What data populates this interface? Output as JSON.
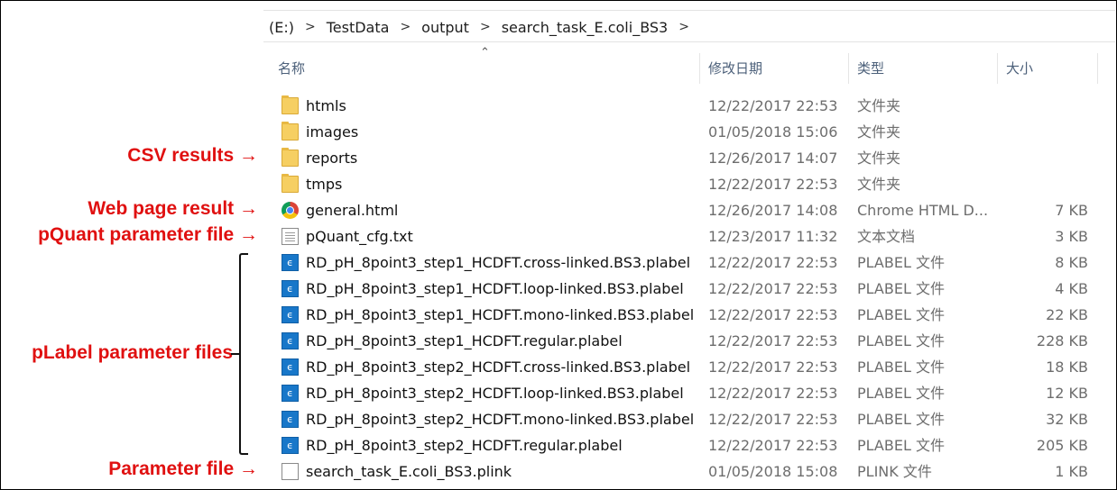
{
  "breadcrumb": [
    "(E:)",
    "TestData",
    "output",
    "search_task_E.coli_BS3"
  ],
  "columns": {
    "name": "名称",
    "date": "修改日期",
    "type": "类型",
    "size": "大小"
  },
  "files": [
    {
      "name": "htmls",
      "date": "12/22/2017 22:53",
      "type": "文件夹",
      "size": "",
      "icon": "folder-icon"
    },
    {
      "name": "images",
      "date": "01/05/2018 15:06",
      "type": "文件夹",
      "size": "",
      "icon": "folder-icon"
    },
    {
      "name": "reports",
      "date": "12/26/2017 14:07",
      "type": "文件夹",
      "size": "",
      "icon": "folder-icon"
    },
    {
      "name": "tmps",
      "date": "12/22/2017 22:53",
      "type": "文件夹",
      "size": "",
      "icon": "folder-icon"
    },
    {
      "name": "general.html",
      "date": "12/26/2017 14:08",
      "type": "Chrome HTML D...",
      "size": "7 KB",
      "icon": "chrome-icon"
    },
    {
      "name": "pQuant_cfg.txt",
      "date": "12/23/2017 11:32",
      "type": "文本文档",
      "size": "3 KB",
      "icon": "text-file-icon"
    },
    {
      "name": "RD_pH_8point3_step1_HCDFT.cross-linked.BS3.plabel",
      "date": "12/22/2017 22:53",
      "type": "PLABEL 文件",
      "size": "8 KB",
      "icon": "plabel-file-icon"
    },
    {
      "name": "RD_pH_8point3_step1_HCDFT.loop-linked.BS3.plabel",
      "date": "12/22/2017 22:53",
      "type": "PLABEL 文件",
      "size": "4 KB",
      "icon": "plabel-file-icon"
    },
    {
      "name": "RD_pH_8point3_step1_HCDFT.mono-linked.BS3.plabel",
      "date": "12/22/2017 22:53",
      "type": "PLABEL 文件",
      "size": "22 KB",
      "icon": "plabel-file-icon"
    },
    {
      "name": "RD_pH_8point3_step1_HCDFT.regular.plabel",
      "date": "12/22/2017 22:53",
      "type": "PLABEL 文件",
      "size": "228 KB",
      "icon": "plabel-file-icon"
    },
    {
      "name": "RD_pH_8point3_step2_HCDFT.cross-linked.BS3.plabel",
      "date": "12/22/2017 22:53",
      "type": "PLABEL 文件",
      "size": "18 KB",
      "icon": "plabel-file-icon"
    },
    {
      "name": "RD_pH_8point3_step2_HCDFT.loop-linked.BS3.plabel",
      "date": "12/22/2017 22:53",
      "type": "PLABEL 文件",
      "size": "12 KB",
      "icon": "plabel-file-icon"
    },
    {
      "name": "RD_pH_8point3_step2_HCDFT.mono-linked.BS3.plabel",
      "date": "12/22/2017 22:53",
      "type": "PLABEL 文件",
      "size": "32 KB",
      "icon": "plabel-file-icon"
    },
    {
      "name": "RD_pH_8point3_step2_HCDFT.regular.plabel",
      "date": "12/22/2017 22:53",
      "type": "PLABEL 文件",
      "size": "205 KB",
      "icon": "plabel-file-icon"
    },
    {
      "name": "search_task_E.coli_BS3.plink",
      "date": "01/05/2018 15:08",
      "type": "PLINK 文件",
      "size": "1 KB",
      "icon": "plain-file-icon"
    }
  ],
  "annotations": {
    "csv": "CSV results →",
    "web": "Web page result →",
    "pquant": "pQuant parameter file →",
    "plabel": "pLabel parameter files",
    "param": "Parameter file →"
  },
  "colors": {
    "annotation": "#e01010",
    "header_text": "#4c607a",
    "muted_text": "#6d6d6d"
  }
}
